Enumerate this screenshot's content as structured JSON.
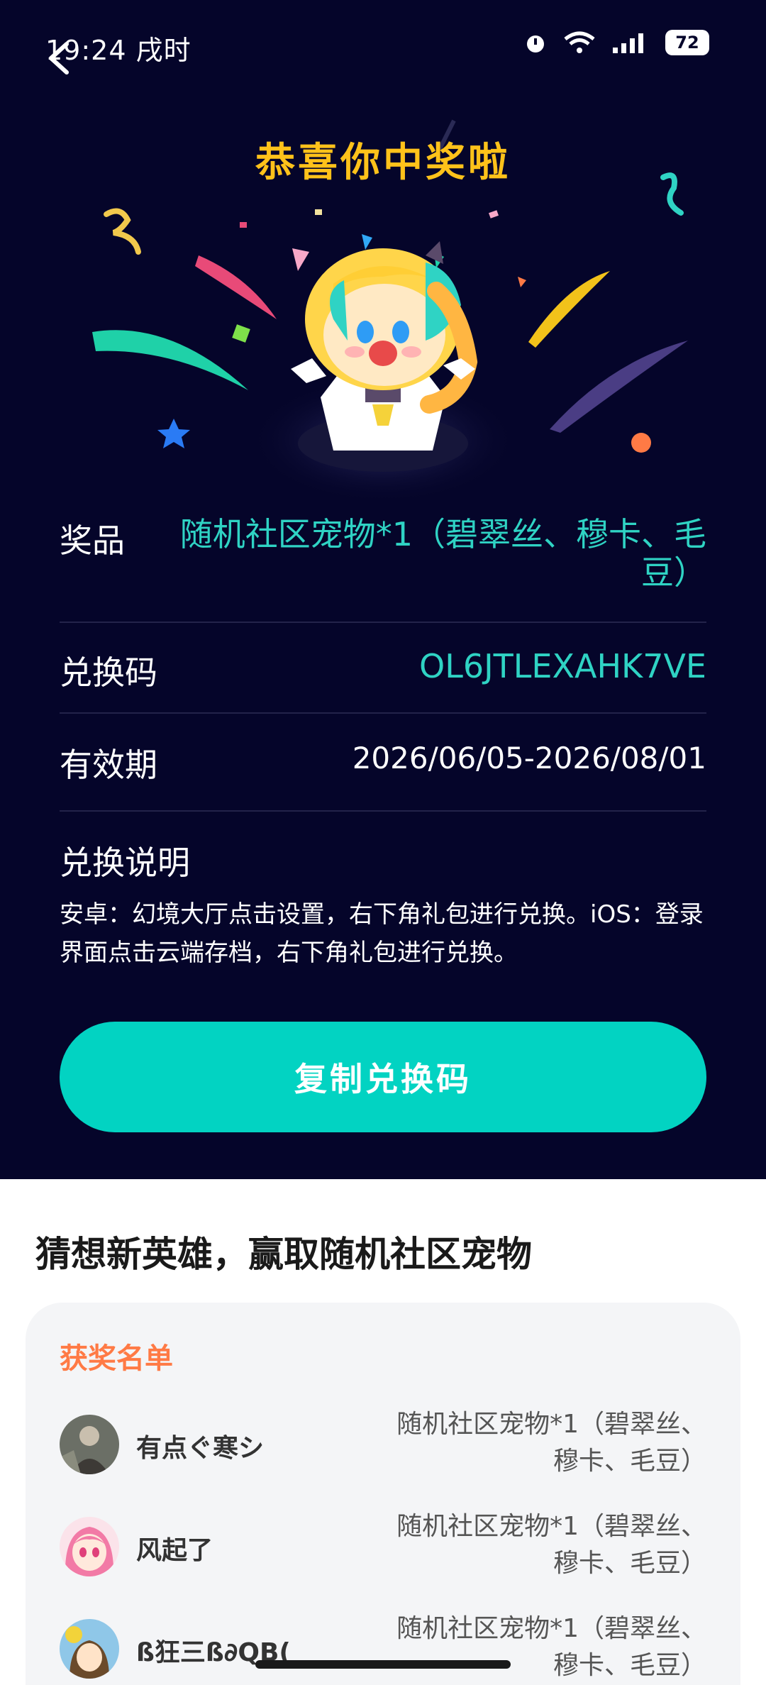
{
  "status_bar": {
    "time": "19:24 戌时",
    "battery": "72"
  },
  "header": {
    "congrats_title": "恭喜你中奖啦"
  },
  "prize": {
    "label": "奖品",
    "value": "随机社区宠物*1（碧翠丝、穆卡、毛豆）"
  },
  "code": {
    "label": "兑换码",
    "value": "OL6JTLEXAHK7VE"
  },
  "validity": {
    "label": "有效期",
    "value": "2026/06/05-2026/08/01"
  },
  "instructions": {
    "title": "兑换说明",
    "text": "安卓：幻境大厅点击设置，右下角礼包进行兑换。iOS：登录界面点击云端存档，右下角礼包进行兑换。"
  },
  "copy_button": {
    "label": "复制兑换码"
  },
  "event": {
    "title": "猜想新英雄，赢取随机社区宠物"
  },
  "winners": {
    "title": "获奖名单",
    "items": [
      {
        "name": "有点ぐ寒シ",
        "prize": "随机社区宠物*1（碧翠丝、穆卡、毛豆）"
      },
      {
        "name": "风起了",
        "prize": "随机社区宠物*1（碧翠丝、穆卡、毛豆）"
      },
      {
        "name": "ß狂三ß∂QB(",
        "prize": "随机社区宠物*1（碧翠丝、穆卡、毛豆）"
      }
    ]
  },
  "colors": {
    "background": "#05052a",
    "accent": "#02d3c2",
    "title_yellow": "#ffc21a",
    "winner_title": "#ff7a45"
  },
  "icons": [
    "back-arrow-icon",
    "alarm-icon",
    "wifi-icon",
    "signal-icon",
    "battery-icon"
  ]
}
